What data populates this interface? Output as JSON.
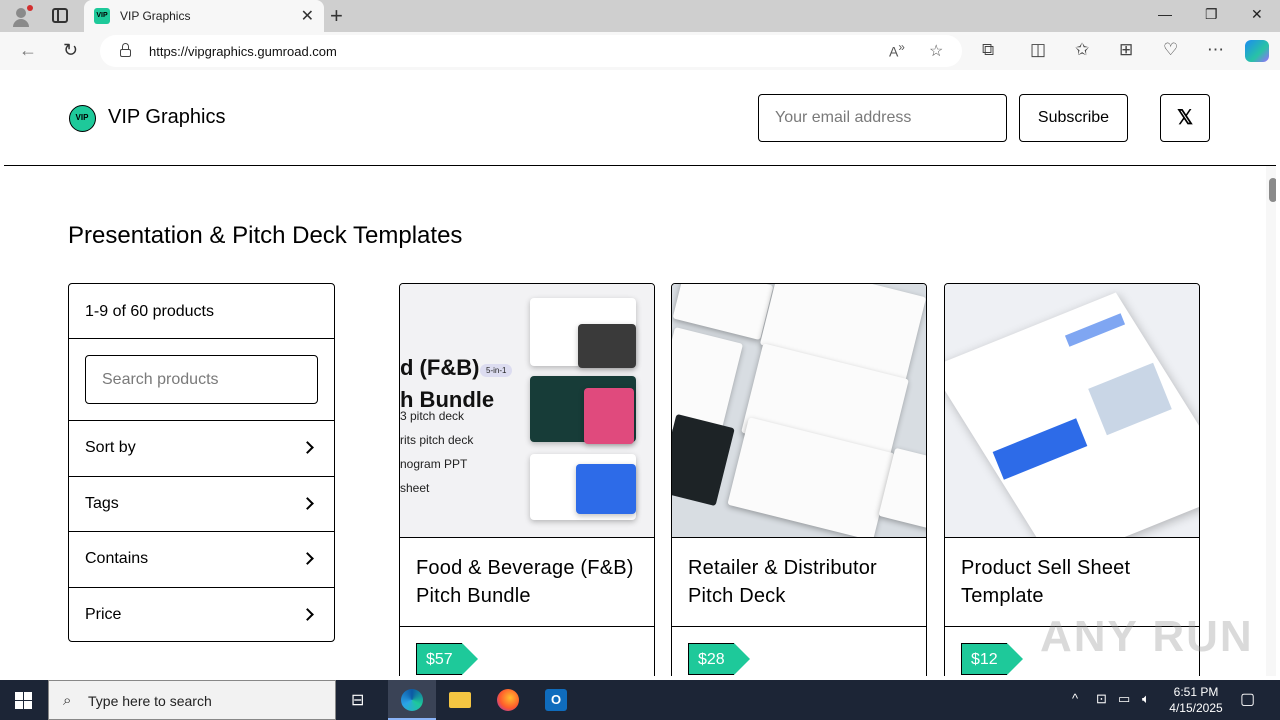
{
  "browser": {
    "tab_title": "VIP Graphics",
    "tab_favicon": "VIP",
    "url": "https://vipgraphics.gumroad.com",
    "icons": [
      "profile-icon",
      "tab-actions-icon",
      "close-tab-icon",
      "new-tab-icon",
      "minimize-icon",
      "maximize-icon",
      "close-window-icon",
      "back-icon",
      "reload-icon",
      "lock-icon",
      "read-aloud-icon",
      "favorite-star-icon",
      "extensions-icon",
      "split-screen-icon",
      "favorites-icon",
      "collections-icon",
      "browser-essentials-icon",
      "more-icon",
      "copilot-icon"
    ]
  },
  "header": {
    "brand_name": "VIP Graphics",
    "logo_text": "VIP",
    "email_placeholder": "Your email address",
    "subscribe_label": "Subscribe",
    "x_label": "𝕏"
  },
  "main": {
    "section_title": "Presentation & Pitch Deck Templates",
    "filters": {
      "count_text": "1-9 of 60 products",
      "search_placeholder": "Search products",
      "items": [
        {
          "label": "Sort by"
        },
        {
          "label": "Tags"
        },
        {
          "label": "Contains"
        },
        {
          "label": "Price"
        }
      ]
    },
    "products": [
      {
        "name": "Food & Beverage (F&B) Pitch Bundle",
        "price": "$57"
      },
      {
        "name": "Retailer & Distributor Pitch Deck",
        "price": "$28"
      },
      {
        "name": "Product Sell Sheet Template",
        "price": "$12"
      }
    ],
    "thumb1": {
      "big_lines": [
        "d (F&B)",
        "h Bundle"
      ],
      "pill": "5-in-1",
      "lines": [
        "3 pitch deck",
        "rits pitch deck",
        "nogram PPT",
        "sheet"
      ]
    }
  },
  "watermark": "ANY RUN",
  "taskbar": {
    "search_placeholder": "Type here to search",
    "time": "6:51 PM",
    "date": "4/15/2025"
  },
  "colors": {
    "accent": "#1ec99a",
    "taskbar": "#1c2536"
  }
}
